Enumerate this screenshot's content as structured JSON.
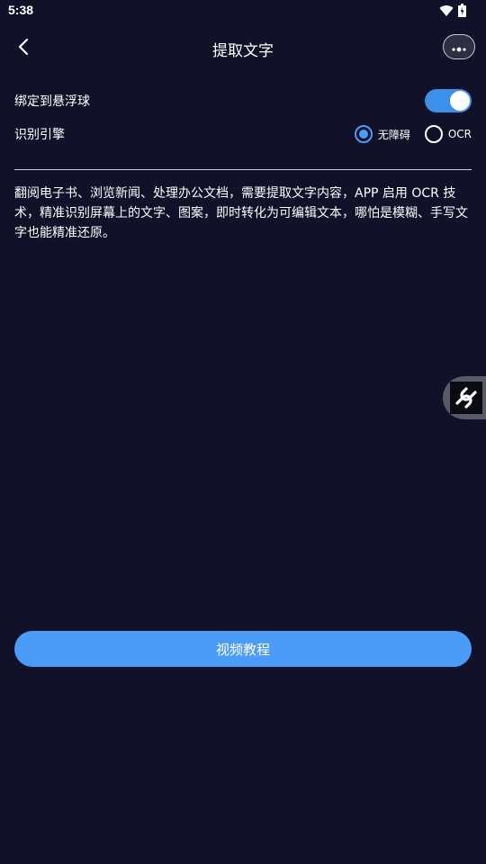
{
  "status_bar": {
    "time": "5:38",
    "icons": [
      "wifi-icon",
      "battery-icon"
    ]
  },
  "header": {
    "title": "提取文字",
    "back_icon": "chevron-left-icon",
    "more_icon": "more-dots-icon"
  },
  "settings": {
    "bind_float": {
      "label": "绑定到悬浮球",
      "enabled": true
    },
    "engine": {
      "label": "识别引擎",
      "options": [
        {
          "label": "无障碍",
          "selected": true
        },
        {
          "label": "OCR",
          "selected": false
        }
      ]
    }
  },
  "description": "翻阅电子书、浏览新闻、处理办公文档，需要提取文字内容，APP 启用 OCR 技术，精准识别屏幕上的文字、图案，即时转化为可编辑文本，哪怕是模糊、手写文字也能精准还原。",
  "float_ball": {
    "icon": "float-ball-logo-icon"
  },
  "tutorial_button": {
    "label": "视频教程"
  },
  "colors": {
    "background": "#11112a",
    "accent": "#4b9cf7",
    "toggle_on": "#3d8fe8"
  }
}
